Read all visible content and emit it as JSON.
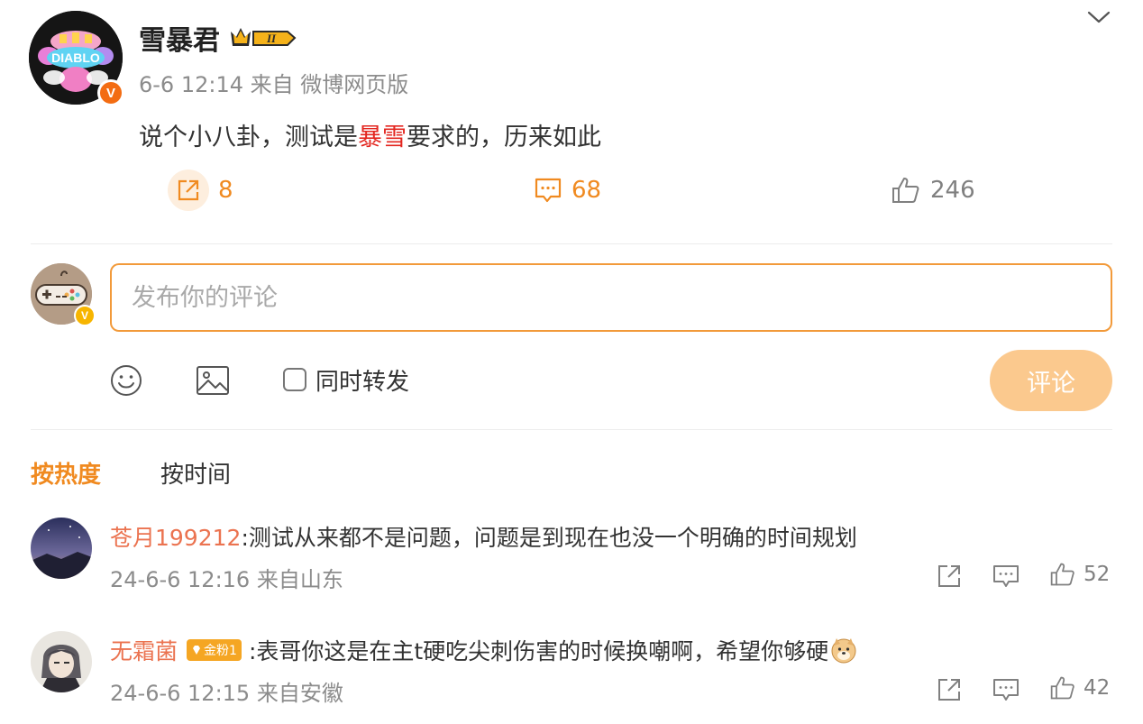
{
  "post": {
    "username": "雪暴君",
    "vip_level": "II",
    "meta": "6-6 12:14 来自 微博网页版",
    "text_before": "说个小八卦，测试是",
    "text_highlight": "暴雪",
    "text_after": "要求的，历来如此",
    "repost_count": "8",
    "comment_count": "68",
    "like_count": "246",
    "avatar_text": "DIABLO",
    "verified_mark": "V"
  },
  "composer": {
    "placeholder": "发布你的评论",
    "repost_label": "同时转发",
    "submit_label": "评论"
  },
  "sort": {
    "hot": "按热度",
    "time": "按时间"
  },
  "comments": [
    {
      "user": "苍月199212",
      "text": ":测试从来都不是问题，问题是到现在也没一个明确的时间规划",
      "meta": "24-6-6 12:16 来自山东",
      "likes": "52"
    },
    {
      "user": "无霜菌",
      "fan_badge": "金粉1",
      "text": ":表哥你这是在主t硬吃尖刺伤害的时候换嘲啊，希望你够硬",
      "meta": "24-6-6 12:15 来自安徽",
      "likes": "42"
    }
  ],
  "colors": {
    "accent": "#f08a20",
    "highlight_red": "#e3261f",
    "username_orange": "#eb7350",
    "muted": "#8c8c8c",
    "submit_disabled": "#fbc98e"
  }
}
